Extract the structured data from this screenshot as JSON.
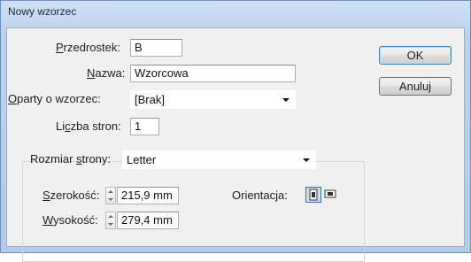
{
  "window": {
    "title": "Nowy wzorzec"
  },
  "form": {
    "prefix": {
      "label_u": "P",
      "label_rest": "rzedrostek:",
      "value": "B"
    },
    "name": {
      "label_u": "N",
      "label_rest": "azwa:",
      "value": "Wzorcowa"
    },
    "based_on": {
      "label_u": "O",
      "label_rest": "party o wzorzec:",
      "value": "[Brak]"
    },
    "pages": {
      "label_pre": "Li",
      "label_u": "c",
      "label_rest": "zba stron:",
      "value": "1"
    },
    "page_size": {
      "label_pre": "Rozmiar ",
      "label_u": "s",
      "label_rest": "trony:",
      "value": "Letter"
    },
    "width": {
      "label_u": "S",
      "label_rest": "zerokość:",
      "value": "215,9 mm"
    },
    "height": {
      "label_u": "W",
      "label_rest": "ysokość:",
      "value": "279,4 mm"
    },
    "orientation": {
      "label": "Orientacja:",
      "selected": "portrait"
    }
  },
  "buttons": {
    "ok": "OK",
    "cancel": "Anuluj"
  },
  "icons": {
    "portrait": "portrait-orientation-icon",
    "landscape": "landscape-orientation-icon"
  }
}
